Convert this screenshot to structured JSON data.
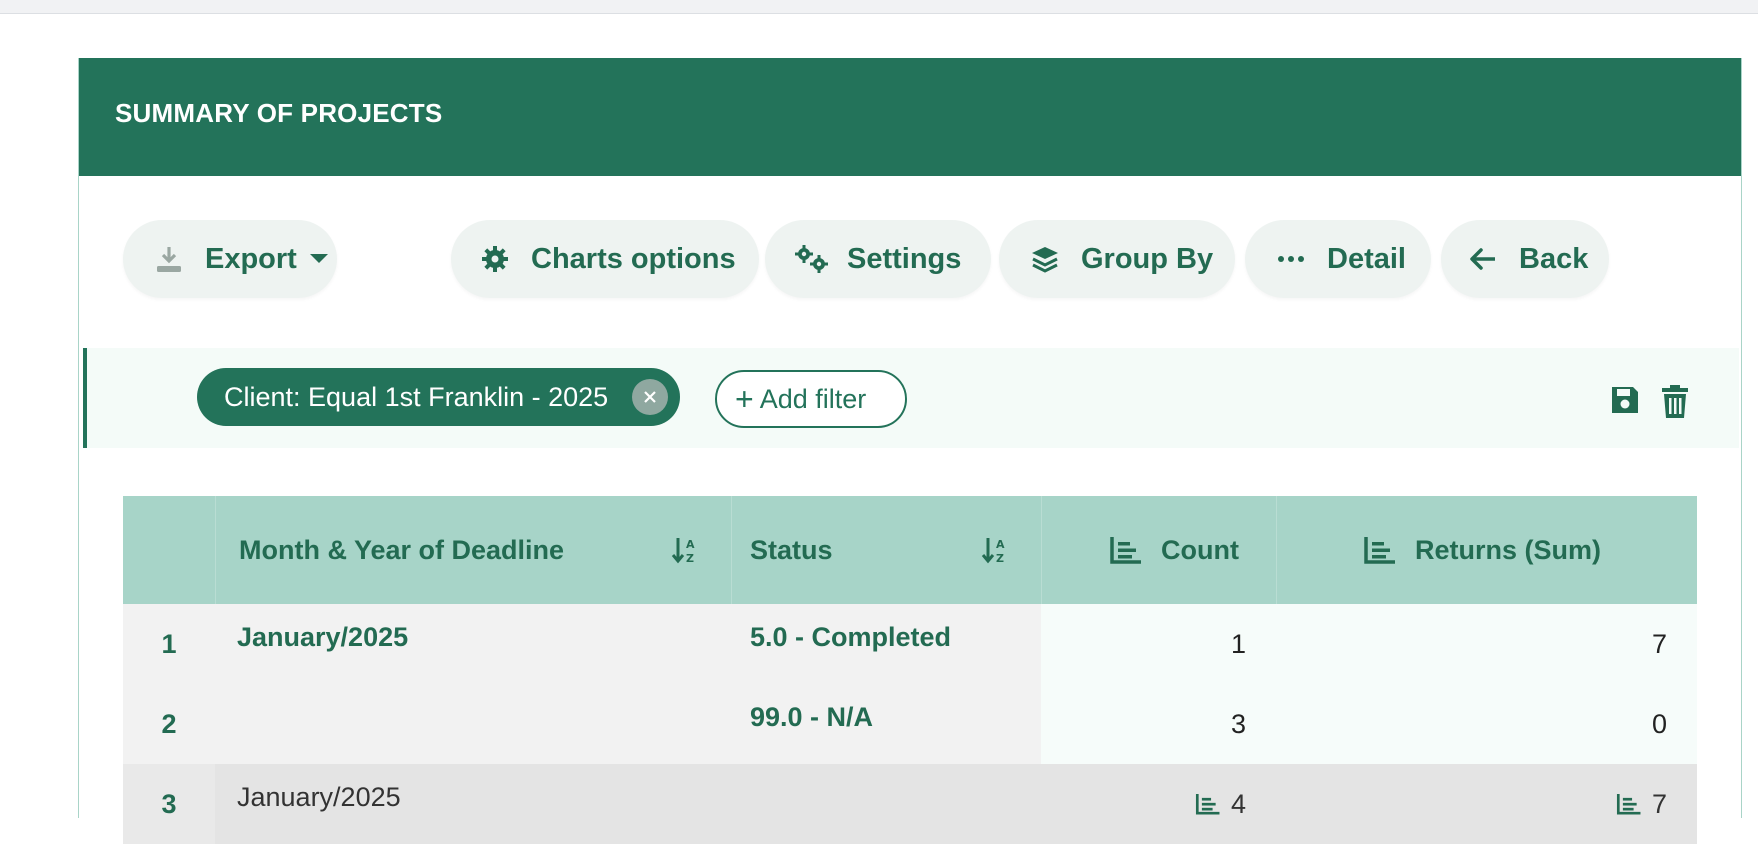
{
  "card": {
    "title": "SUMMARY OF PROJECTS"
  },
  "toolbar": {
    "export_label": "Export",
    "charts_label": "Charts options",
    "settings_label": "Settings",
    "groupby_label": "Group By",
    "detail_label": "Detail",
    "back_label": "Back"
  },
  "filters": {
    "chip_label": "Client: Equal 1st Franklin - 2025",
    "add_label": "Add filter"
  },
  "grid": {
    "headers": [
      "Month & Year of Deadline",
      "Status",
      "Count",
      "Returns (Sum)"
    ],
    "rows": [
      {
        "index": "1",
        "month": "January/2025",
        "status": "5.0 - Completed",
        "count": "1",
        "returns": "7"
      },
      {
        "index": "2",
        "month": "",
        "status": "99.0 - N/A",
        "count": "3",
        "returns": "0"
      }
    ],
    "subtotal": {
      "index": "3",
      "month": "January/2025",
      "count": "4",
      "returns": "7"
    }
  },
  "colors": {
    "primary": "#23735a",
    "header_bg": "#a7d4c8",
    "button_bg": "#eef3f1"
  },
  "icons": [
    "download-icon",
    "caret-down-icon",
    "gear-icon",
    "gears-icon",
    "layers-icon",
    "ellipsis-icon",
    "arrow-left-icon",
    "close-icon",
    "plus-icon",
    "save-icon",
    "trash-icon",
    "sort-alpha-icon",
    "bar-chart-icon"
  ]
}
